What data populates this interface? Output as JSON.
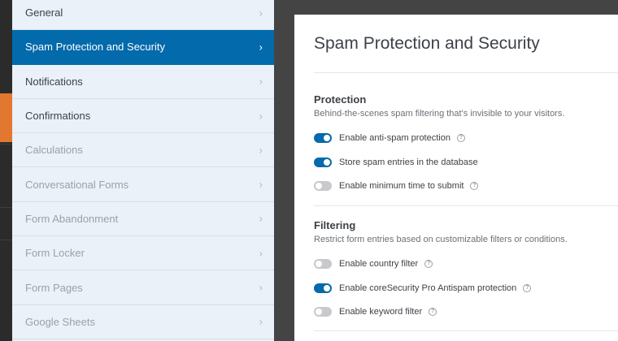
{
  "sidebar": {
    "items": [
      {
        "label": "General",
        "state": "normal"
      },
      {
        "label": "Spam Protection and Security",
        "state": "active"
      },
      {
        "label": "Notifications",
        "state": "normal"
      },
      {
        "label": "Confirmations",
        "state": "normal"
      },
      {
        "label": "Calculations",
        "state": "disabled"
      },
      {
        "label": "Conversational Forms",
        "state": "disabled"
      },
      {
        "label": "Form Abandonment",
        "state": "disabled"
      },
      {
        "label": "Form Locker",
        "state": "disabled"
      },
      {
        "label": "Form Pages",
        "state": "disabled"
      },
      {
        "label": "Google Sheets",
        "state": "disabled"
      }
    ],
    "chevron": "›"
  },
  "main": {
    "title": "Spam Protection and Security",
    "sections": [
      {
        "title": "Protection",
        "description": "Behind-the-scenes spam filtering that's invisible to your visitors.",
        "options": [
          {
            "label": "Enable anti-spam protection",
            "enabled": true,
            "help": true
          },
          {
            "label": "Store spam entries in the database",
            "enabled": true,
            "help": false
          },
          {
            "label": "Enable minimum time to submit",
            "enabled": false,
            "help": true
          }
        ]
      },
      {
        "title": "Filtering",
        "description": "Restrict form entries based on customizable filters or conditions.",
        "options": [
          {
            "label": "Enable country filter",
            "enabled": false,
            "help": true
          },
          {
            "label": "Enable coreSecurity Pro Antispam protection",
            "enabled": true,
            "help": true
          },
          {
            "label": "Enable keyword filter",
            "enabled": false,
            "help": true
          }
        ]
      }
    ]
  },
  "help_glyph": "?",
  "colors": {
    "accent": "#036aab",
    "toggle_on": "#056aab",
    "toggle_off": "#c7c9cc",
    "menu_bg": "#eaf1f8",
    "edge_orange": "#e27730"
  }
}
